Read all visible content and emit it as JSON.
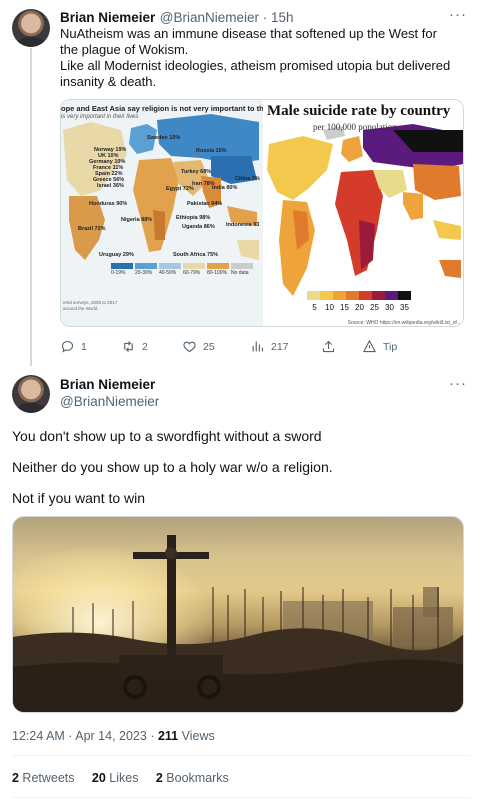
{
  "tweet1": {
    "author_name": "Brian Niemeier",
    "author_handle": "@BrianNiemeier",
    "separator": " · ",
    "time": "15h",
    "more_icon": "more-horizontal-icon",
    "text_lines": [
      "NuAtheism was an immune disease that softened up the West for the plague of Wokism.",
      "Like all Modernist ideologies, atheism promised utopia but delivered insanity & death."
    ],
    "media": {
      "left_map": {
        "title": "ope and East Asia say religion is not very important to the",
        "subtitle": "is very important in their lives",
        "labels": [
          "Sweden 10%",
          "Norway 19%",
          "UK 10%",
          "Germany 10%",
          "France 11%",
          "Spain 22%",
          "Greece 56%",
          "Israel 36%",
          "Russia 15%",
          "Iran 78%",
          "Egypt 72%",
          "Turkey 68%",
          "India 80%",
          "Pakistan 94%",
          "China 3%",
          "Ethiopia 98%",
          "Uganda 86%",
          "Nigeria 88%",
          "Indonesia 93",
          "Honduras 90%",
          "Brazil 72%",
          "Uruguay 29%",
          "South Africa 75%"
        ],
        "legend": [
          "0-19%",
          "20-39%",
          "40-59%",
          "60-79%",
          "80-100%",
          "No data"
        ],
        "footnote": "ertal surveys, 2008 to 2017\n around the World"
      },
      "right_map": {
        "title": "Male suicide rate by country",
        "subtitle": "per 100,000 population",
        "legend": [
          "5",
          "10",
          "15",
          "20",
          "25",
          "30",
          "35"
        ],
        "legend_colors": [
          "#e8dc8c",
          "#f2c94c",
          "#eea43a",
          "#e07b2d",
          "#d43b2a",
          "#9b1b3a",
          "#5a1a7e",
          "#111111"
        ],
        "source": "Source: WHO  https://en.wikipedia.org/wiki/List_of..."
      }
    },
    "actions": {
      "reply": {
        "icon": "reply-icon",
        "count": "1"
      },
      "retweet": {
        "icon": "retweet-icon",
        "count": "2"
      },
      "like": {
        "icon": "heart-icon",
        "count": "25"
      },
      "views": {
        "icon": "views-chart-icon",
        "count": "217"
      },
      "share": {
        "icon": "share-icon",
        "count": ""
      },
      "tip": {
        "icon": "tip-icon",
        "label": "Tip"
      }
    }
  },
  "tweet2": {
    "author_name": "Brian Niemeier",
    "author_handle": "@BrianNiemeier",
    "more_icon": "more-horizontal-icon",
    "paragraphs": [
      "You don't show up to a swordfight without a sword",
      "Neither do you show up to a holy war w/o a religion.",
      "Not if you want to win"
    ],
    "media_alt": "Crusader army marching with a large cross",
    "meta": {
      "time": "12:24 AM",
      "separator": " · ",
      "date": "Apr 14, 2023",
      "views_count": "211",
      "views_label": " Views"
    },
    "stats": {
      "retweets_count": "2",
      "retweets_label": " Retweets",
      "likes_count": "20",
      "likes_label": " Likes",
      "bookmarks_count": "2",
      "bookmarks_label": " Bookmarks"
    }
  }
}
